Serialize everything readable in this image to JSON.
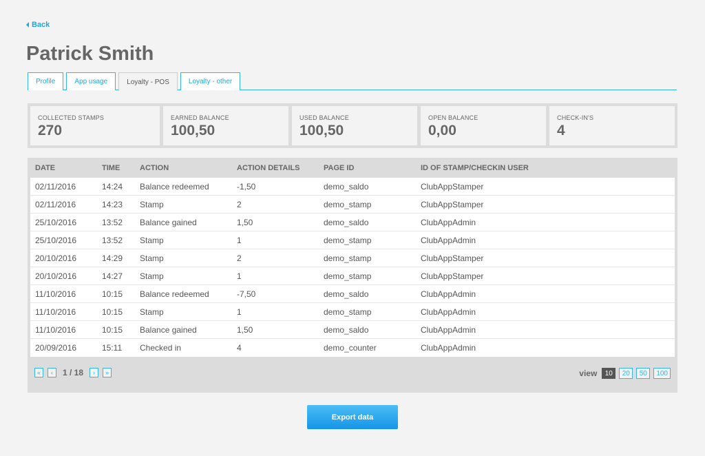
{
  "back_label": "Back",
  "page_title": "Patrick Smith",
  "tabs": [
    {
      "label": "Profile"
    },
    {
      "label": "App usage"
    },
    {
      "label": "Loyalty - POS"
    },
    {
      "label": "Loyalty - other"
    }
  ],
  "stats": [
    {
      "label": "COLLECTED STAMPS",
      "value": "270"
    },
    {
      "label": "EARNED BALANCE",
      "value": "100,50"
    },
    {
      "label": "USED BALANCE",
      "value": "100,50"
    },
    {
      "label": "OPEN BALANCE",
      "value": "0,00"
    },
    {
      "label": "CHECK-IN'S",
      "value": "4"
    }
  ],
  "table": {
    "headers": [
      "DATE",
      "TIME",
      "ACTION",
      "ACTION DETAILS",
      "PAGE ID",
      "ID OF STAMP/CHECKIN USER"
    ],
    "rows": [
      [
        "02/11/2016",
        "14:24",
        "Balance redeemed",
        "-1,50",
        "demo_saldo",
        "ClubAppStamper"
      ],
      [
        "02/11/2016",
        "14:23",
        "Stamp",
        "2",
        "demo_stamp",
        "ClubAppStamper"
      ],
      [
        "25/10/2016",
        "13:52",
        "Balance gained",
        "1,50",
        "demo_saldo",
        "ClubAppAdmin"
      ],
      [
        "25/10/2016",
        "13:52",
        "Stamp",
        "1",
        "demo_stamp",
        "ClubAppAdmin"
      ],
      [
        "20/10/2016",
        "14:29",
        "Stamp",
        "2",
        "demo_stamp",
        "ClubAppStamper"
      ],
      [
        "20/10/2016",
        "14:27",
        "Stamp",
        "1",
        "demo_stamp",
        "ClubAppStamper"
      ],
      [
        "11/10/2016",
        "10:15",
        "Balance redeemed",
        "-7,50",
        "demo_saldo",
        "ClubAppAdmin"
      ],
      [
        "11/10/2016",
        "10:15",
        "Stamp",
        "1",
        "demo_stamp",
        "ClubAppAdmin"
      ],
      [
        "11/10/2016",
        "10:15",
        "Balance gained",
        "1,50",
        "demo_saldo",
        "ClubAppAdmin"
      ],
      [
        "20/09/2016",
        "15:11",
        "Checked in",
        "4",
        "demo_counter",
        "ClubAppAdmin"
      ]
    ]
  },
  "pager": {
    "first": "«",
    "prev": "‹",
    "info": "1 / 18",
    "next": "›",
    "last": "»"
  },
  "view": {
    "label": "view",
    "options": [
      "10",
      "20",
      "50",
      "100"
    ],
    "selected": "10"
  },
  "export_label": "Export data",
  "colors": {
    "accent": "#33b5e5",
    "button": "#1e9eea"
  }
}
